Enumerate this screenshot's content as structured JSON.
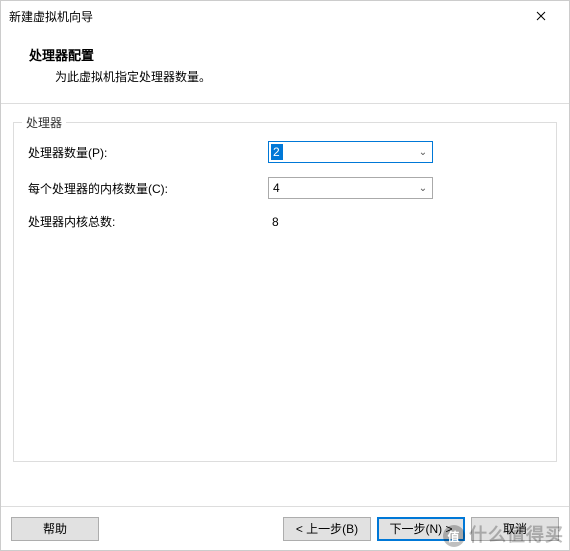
{
  "titlebar": {
    "title": "新建虚拟机向导"
  },
  "header": {
    "title": "处理器配置",
    "subtitle": "为此虚拟机指定处理器数量。"
  },
  "fieldset": {
    "legend": "处理器",
    "rows": {
      "processors": {
        "label": "处理器数量(P):",
        "value": "2"
      },
      "cores": {
        "label": "每个处理器的内核数量(C):",
        "value": "4"
      },
      "total": {
        "label": "处理器内核总数:",
        "value": "8"
      }
    }
  },
  "buttons": {
    "help": "帮助",
    "back": "< 上一步(B)",
    "next": "下一步(N) >",
    "cancel": "取消"
  },
  "watermark": {
    "text": "什么值得买"
  }
}
